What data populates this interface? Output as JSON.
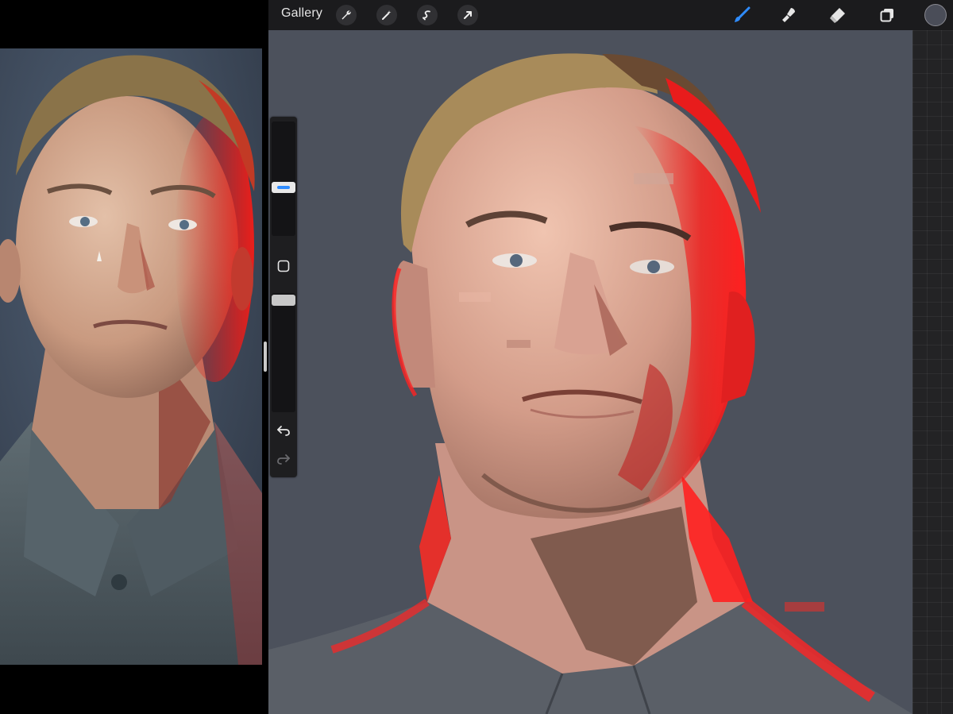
{
  "toolbar": {
    "gallery_label": "Gallery",
    "left_tools": [
      "wrench-icon",
      "magic-wand-icon",
      "selection-icon",
      "transform-arrow-icon"
    ],
    "right_tools": [
      "brush-icon",
      "smudge-icon",
      "eraser-icon",
      "layers-icon"
    ],
    "active_tool": "brush-icon",
    "active_color": "#4a4d58",
    "accent_color": "#2f8cff"
  },
  "sidebar": {
    "brush_size_slider": {
      "active": true
    },
    "opacity_slider": {
      "active": false
    },
    "modify_button_icon": "square-icon",
    "undo_icon": "undo-arrow-icon",
    "redo_icon": "redo-arrow-icon"
  },
  "reference": {
    "visible": true
  },
  "canvas": {
    "background_color": "#4c515c",
    "rim_light_color": "#e8191a"
  }
}
